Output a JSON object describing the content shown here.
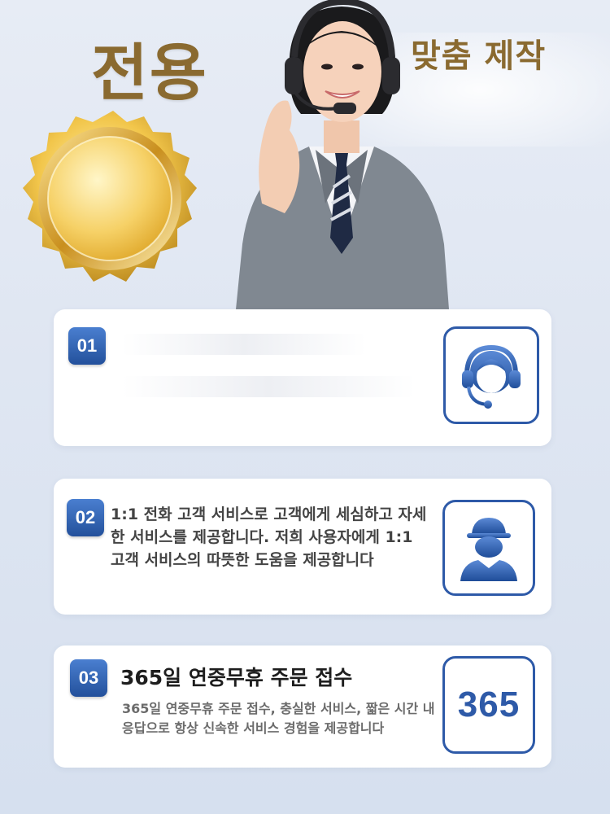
{
  "header": {
    "title": "전용",
    "subtitle": "맞춤 제작"
  },
  "cards": [
    {
      "number": "01",
      "icon": "customer-service-headset-icon"
    },
    {
      "number": "02",
      "icon": "worker-helmet-icon",
      "text": "1:1 전화 고객 서비스로 고객에게 세심하고 자세한 서비스를 제공합니다. 저희 사용자에게 1:1 고객 서비스의 따뜻한 도움을 제공합니다"
    },
    {
      "number": "03",
      "icon": "365-days-icon",
      "title": "365일 연중무휴 주문 접수",
      "text": "365일 연중무휴 주문 접수, 충실한 서비스, 짧은 시간 내 응답으로 항상 신속한 서비스 경험을 제공합니다",
      "icon_text": "365"
    }
  ],
  "colors": {
    "accent": "#2e5aa8",
    "gold_text": "#8a6a30",
    "card_bg": "#ffffff"
  }
}
